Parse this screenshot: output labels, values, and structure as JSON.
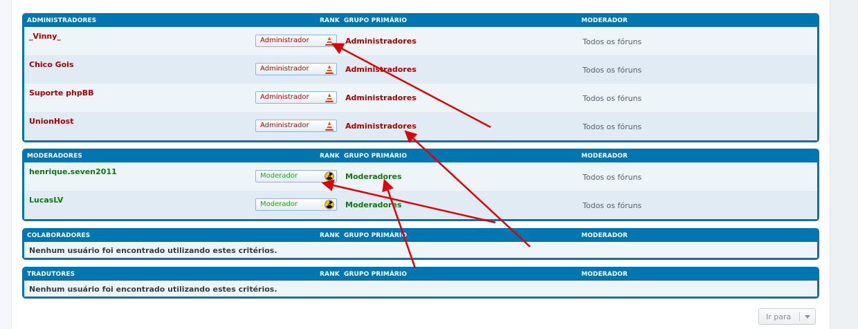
{
  "columns": {
    "rank": "RANK",
    "group": "GRUPO PRIMÁRIO",
    "moderator": "MODERADOR"
  },
  "sections": [
    {
      "title": "ADMINISTRADORES",
      "rows": [
        {
          "name": "_Vinny_",
          "rank": "Administrador",
          "group": "Administradores",
          "moderator": "Todos os fóruns"
        },
        {
          "name": "Chico Gois",
          "rank": "Administrador",
          "group": "Administradores",
          "moderator": "Todos os fóruns"
        },
        {
          "name": "Suporte phpBB",
          "rank": "Administrador",
          "group": "Administradores",
          "moderator": "Todos os fóruns"
        },
        {
          "name": "UnionHost",
          "rank": "Administrador",
          "group": "Administradores",
          "moderator": "Todos os fóruns"
        }
      ]
    },
    {
      "title": "MODERADORES",
      "rows": [
        {
          "name": "henrique.seven2011",
          "rank": "Moderador",
          "group": "Moderadores",
          "moderator": "Todos os fóruns"
        },
        {
          "name": "LucasLV",
          "rank": "Moderador",
          "group": "Moderadores",
          "moderator": "Todos os fóruns"
        }
      ]
    },
    {
      "title": "COLABORADORES",
      "empty_message": "Nenhum usuário foi encontrado utilizando estes critérios."
    },
    {
      "title": "TRADUTORES",
      "empty_message": "Nenhum usuário foi encontrado utilizando estes critérios."
    }
  ],
  "jump_box": {
    "label": "Ir para"
  },
  "icons": {
    "admin_rank": "traffic-cone-icon",
    "moderator_rank": "radiation-icon",
    "jump_caret": "chevron-down-icon"
  },
  "colors": {
    "panel": "#0076b1",
    "admin": "#b00000",
    "moderator": "#0d7a0d",
    "annotation": "#e00000"
  }
}
